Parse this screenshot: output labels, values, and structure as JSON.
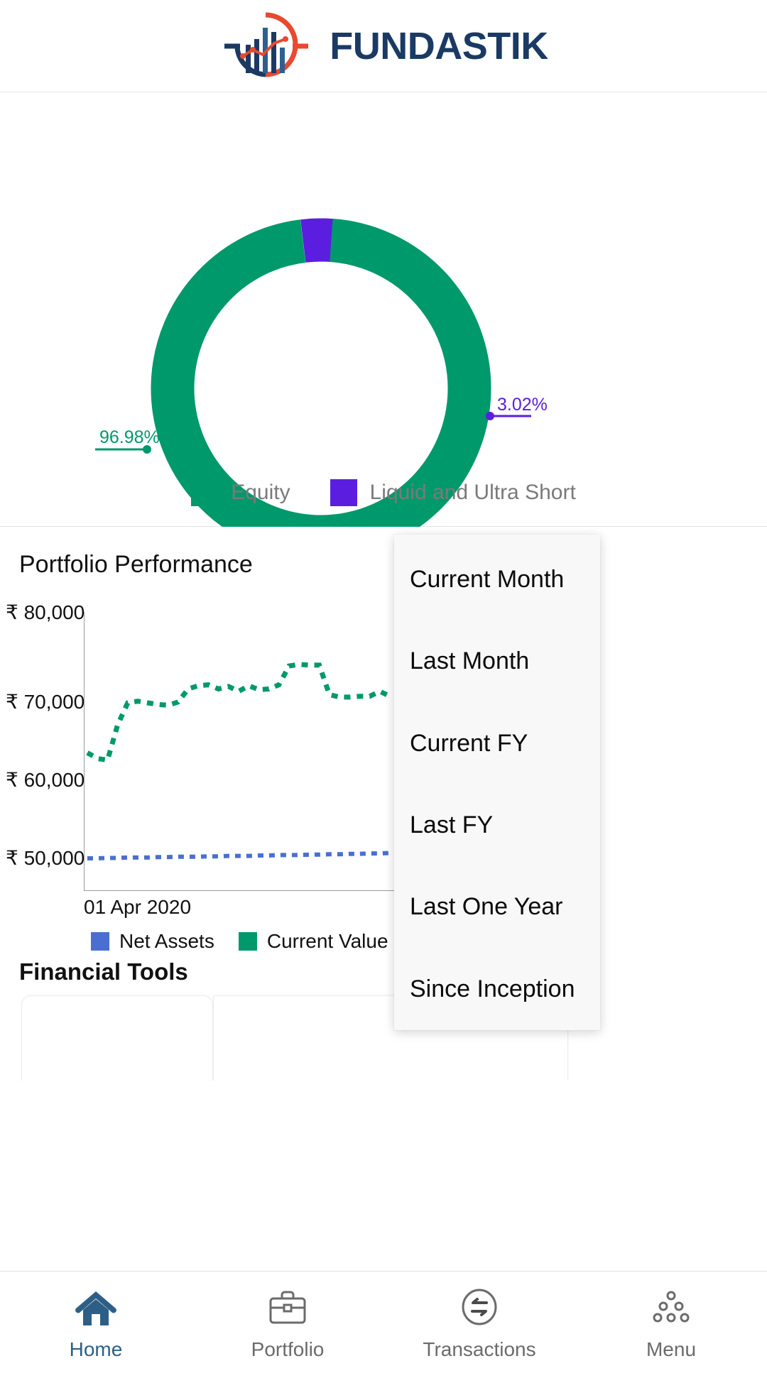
{
  "header": {
    "brand": "FUNDASTIK",
    "logo_icon": "fundastik-bar-chart-target-logo",
    "brand_color": "#1b3a63",
    "accent_color": "#e8492f"
  },
  "allocation": {
    "labels": [
      "96.98%",
      "3.02%"
    ],
    "legend": [
      {
        "label": "Equity",
        "color": "#00996b"
      },
      {
        "label": "Liquid and Ultra Short",
        "color": "#5b1ee0"
      }
    ],
    "chart_data": {
      "type": "pie",
      "title": "",
      "categories": [
        "Equity",
        "Liquid and Ultra Short"
      ],
      "values": [
        96.98,
        3.02
      ],
      "value_labels": [
        "96.98%",
        "3.02%"
      ],
      "colors": [
        "#00996b",
        "#5b1ee0"
      ],
      "donut": true,
      "inner_radius_ratio": 0.78,
      "legend_position": "bottom",
      "label_colors": [
        "#00996b",
        "#5b1ee0"
      ]
    }
  },
  "performance": {
    "title": "Portfolio Performance",
    "x_axis_label": "01 Apr 2020",
    "y_ticks": [
      "₹ 80,000",
      "₹ 70,000",
      "₹ 60,000",
      "₹ 50,000"
    ],
    "legend": [
      {
        "label": "Net Assets",
        "color": "#4a6fd0"
      },
      {
        "label": "Current Value",
        "color": "#00996b"
      }
    ],
    "chart_data": {
      "type": "line",
      "title": "Portfolio Performance",
      "xlabel": "01 Apr 2020",
      "ylabel": "",
      "ylim": [
        48000,
        82000
      ],
      "ytick_labels": [
        "₹ 80,000",
        "₹ 70,000",
        "₹ 60,000",
        "₹ 50,000"
      ],
      "ytick_values": [
        80000,
        70000,
        60000,
        50000
      ],
      "grid": false,
      "legend_position": "bottom",
      "x": [
        0,
        1,
        2,
        3,
        4,
        5,
        6,
        7,
        8,
        9,
        10,
        11,
        12,
        13,
        14,
        15,
        16,
        17,
        18,
        19,
        20,
        21,
        22,
        23,
        24,
        25,
        26,
        27,
        28,
        29,
        30
      ],
      "series": [
        {
          "name": "Current Value",
          "color": "#00996b",
          "style": "dotted",
          "values": [
            64800,
            64100,
            63900,
            68200,
            70900,
            71100,
            70900,
            70700,
            70600,
            71000,
            72600,
            73000,
            73100,
            72600,
            72900,
            72300,
            73000,
            72500,
            72600,
            73100,
            75400,
            75600,
            75500,
            75500,
            71900,
            71600,
            71600,
            71700,
            71700,
            72300,
            71700
          ]
        },
        {
          "name": "Net Assets",
          "color": "#4a6fd0",
          "style": "dotted",
          "values": [
            51900,
            51900,
            51950,
            51950,
            52000,
            52000,
            52000,
            52050,
            52050,
            52100,
            52100,
            52100,
            52150,
            52150,
            52200,
            52200,
            52200,
            52250,
            52250,
            52300,
            52300,
            52300,
            52350,
            52350,
            52400,
            52400,
            52450,
            52450,
            52500,
            52500,
            52550
          ]
        }
      ]
    }
  },
  "tools": {
    "title": "Financial Tools"
  },
  "dropdown": {
    "items": [
      "Current Month",
      "Last Month",
      "Current FY",
      "Last FY",
      "Last One Year",
      "Since Inception"
    ]
  },
  "bottom_nav": {
    "items": [
      {
        "label": "Home",
        "icon": "home-icon",
        "active": true
      },
      {
        "label": "Portfolio",
        "icon": "briefcase-icon",
        "active": false
      },
      {
        "label": "Transactions",
        "icon": "swap-circle-icon",
        "active": false
      },
      {
        "label": "Menu",
        "icon": "dots-grid-icon",
        "active": false
      }
    ],
    "active_color": "#2d5f86",
    "inactive_color": "#6b6b6b"
  }
}
